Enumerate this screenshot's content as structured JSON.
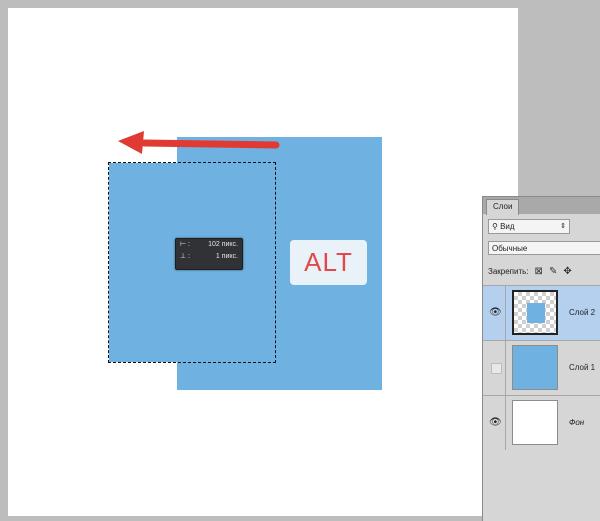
{
  "tooltip": {
    "rows": [
      {
        "icon": "⊢ :",
        "value": "102 пикс."
      },
      {
        "icon": "⊥ :",
        "value": "1 пикс."
      }
    ]
  },
  "annotation": {
    "alt_label": "ALT",
    "arrow_color": "#e03a32"
  },
  "canvas": {
    "shape_color": "#6fb1e0"
  },
  "layers_panel": {
    "tab_label": "Слои",
    "filter": {
      "icon": "search-icon",
      "label": "Вид",
      "arrow": "⇕"
    },
    "blend_mode": "Обычные",
    "lock_label": "Закрепить:",
    "layers": [
      {
        "name": "Слой 2",
        "visible": true,
        "selected": true
      },
      {
        "name": "Слой 1",
        "visible": false,
        "selected": false
      },
      {
        "name": "Фон",
        "visible": true,
        "selected": false
      }
    ]
  }
}
